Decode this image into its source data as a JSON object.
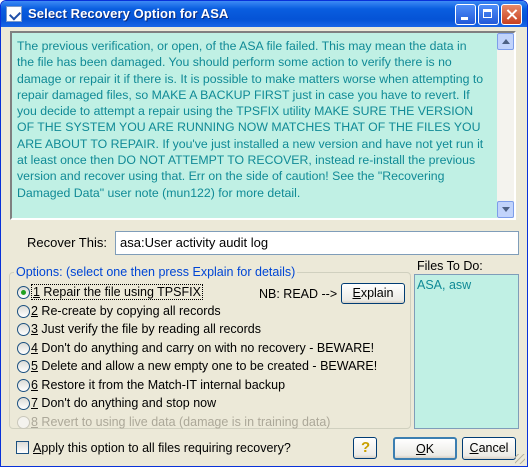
{
  "window": {
    "title": "Select Recovery Option for ASA"
  },
  "message": {
    "text": "The previous verification, or open, of the ASA file failed.  This may mean the data in the file has been damaged.  You should perform some action to verify there is no damage or repair it if there is.  It is possible to make matters worse when attempting to repair damaged files, so MAKE A BACKUP FIRST just in case you have to revert.  If you decide to attempt a repair using the TPSFIX utility MAKE SURE THE VERSION OF THE SYSTEM YOU ARE RUNNING NOW MATCHES THAT OF THE FILES YOU ARE ABOUT TO REPAIR.  If you've just installed a new version and have not yet run it at least once then DO NOT ATTEMPT TO RECOVER, instead re-install the previous version and recover using that.  Err on the side of caution!  See the \"Recovering Damaged Data\" user note (mun122) for more detail."
  },
  "recover": {
    "label": "Recover This:",
    "value": "asa:User activity audit log"
  },
  "options": {
    "title": "Options: (select one then press Explain for details)",
    "items": [
      {
        "key": "1",
        "label": " Repair the file using TPSFIX"
      },
      {
        "key": "2",
        "label": " Re-create by copying all records"
      },
      {
        "key": "3",
        "label": " Just verify the file by reading all records"
      },
      {
        "key": "4",
        "label": " Don't do anything and carry on with no recovery - BEWARE!"
      },
      {
        "key": "5",
        "label": " Delete and allow a new empty one to be created - BEWARE!"
      },
      {
        "key": "6",
        "label": " Restore it from the Match-IT internal backup"
      },
      {
        "key": "7",
        "label": " Don't do anything and stop now"
      },
      {
        "key": "8",
        "label": " Revert to using live data  (damage is in training data)"
      }
    ],
    "selected": "1",
    "disabled": [
      "8"
    ],
    "nb_label": "NB: READ -->",
    "explain_key": "E",
    "explain_rest": "xplain"
  },
  "files": {
    "label": "Files To Do:",
    "items": [
      "ASA, asw"
    ]
  },
  "footer": {
    "apply_key": "A",
    "apply_rest": "pply this option to all files requiring recovery?",
    "ok_key": "O",
    "ok_rest": "K",
    "cancel_key": "C",
    "cancel_rest": "ancel"
  }
}
